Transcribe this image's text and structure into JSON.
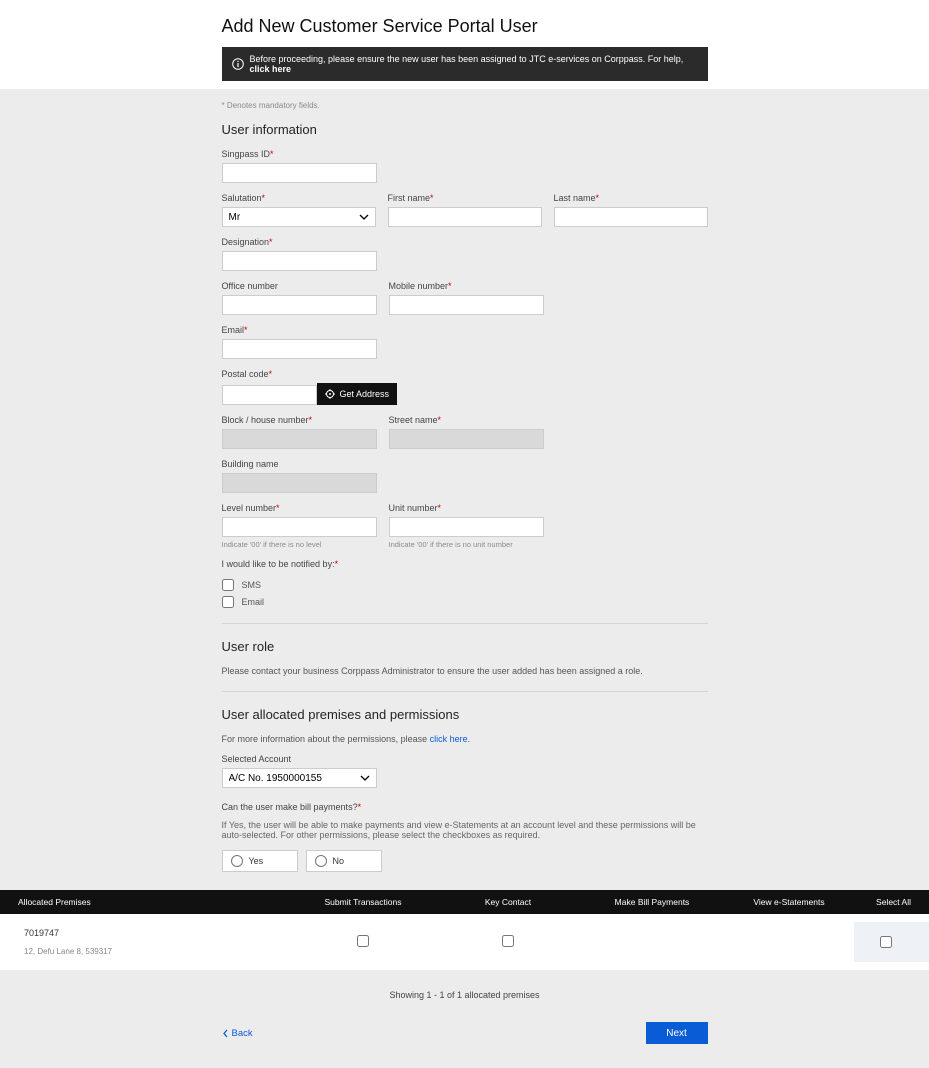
{
  "page": {
    "title": "Add New Customer Service Portal User"
  },
  "alert": {
    "text": "Before proceeding, please ensure the new user has been assigned to JTC e-services on Corppass. For help, ",
    "link": "click here"
  },
  "mandatory": "* Denotes mandatory fields.",
  "sections": {
    "userinfo": {
      "title": "User information"
    },
    "userrole": {
      "title": "User role",
      "desc": "Please contact your business Corppass Administrator to ensure the user added has been assigned a role."
    },
    "premises": {
      "title": "User allocated premises and permissions",
      "desc_pre": "For more information about the permissions, please ",
      "desc_link": "click here",
      "desc_post": "."
    }
  },
  "labels": {
    "singpass": "Singpass ID",
    "salutation": "Salutation",
    "firstname": "First name",
    "lastname": "Last name",
    "designation": "Designation",
    "office": "Office number",
    "mobile": "Mobile number",
    "email": "Email",
    "postal": "Postal code",
    "block": "Block / house number",
    "street": "Street name",
    "building": "Building name",
    "level": "Level number",
    "unit": "Unit number",
    "notify": "I would like to be notified by:",
    "account": "Selected Account",
    "billq": "Can the user make bill payments?",
    "billhelp": "If Yes, the user will be able to make payments and view e-Statements at an account level and these permissions will be auto-selected. For other permissions, please select the checkboxes as required."
  },
  "salutation_value": "Mr",
  "hints": {
    "level": "Indicate '00' if there is no level",
    "unit": "Indicate '00' if there is no unit number"
  },
  "notify_opts": {
    "sms": "SMS",
    "email": "Email"
  },
  "get_address": "Get Address",
  "account_value": "A/C No. 1950000155",
  "radio": {
    "yes": "Yes",
    "no": "No"
  },
  "table": {
    "headers": {
      "allocated": "Allocated Premises",
      "submit": "Submit Transactions",
      "keycontact": "Key Contact",
      "makebill": "Make Bill Payments",
      "viewe": "View e-Statements",
      "selectall": "Select All"
    },
    "row": {
      "id": "7019747",
      "addr": "12, Defu Lane 8, 539317"
    },
    "pager": "Showing 1 - 1 of 1 allocated premises"
  },
  "nav": {
    "back": "Back",
    "next": "Next"
  }
}
